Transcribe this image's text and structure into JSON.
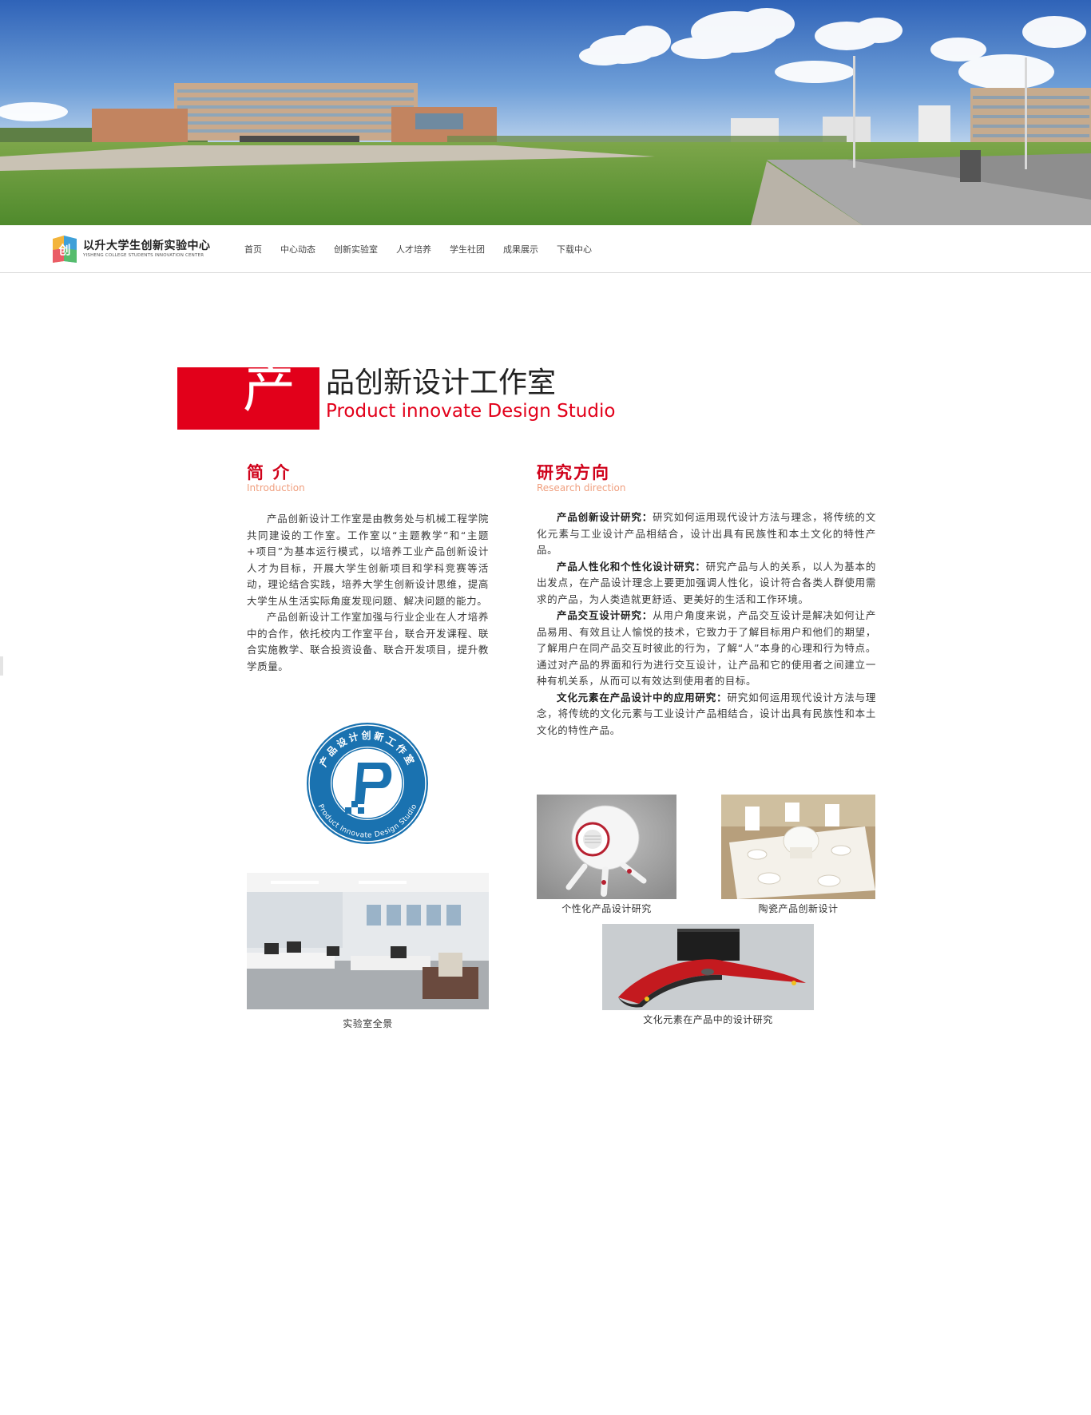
{
  "brand": {
    "name_cn": "以升大学生创新实验中心",
    "name_en": "YISHENG COLLEGE STUDENTS INNOVATION CENTER"
  },
  "nav": {
    "items": [
      "首页",
      "中心动态",
      "创新实验室",
      "人才培养",
      "学生社团",
      "成果展示",
      "下载中心"
    ]
  },
  "page_title": {
    "char": "产",
    "rest_cn": "品创新设计工作室",
    "en": "Product innovate Design Studio"
  },
  "intro": {
    "heading_cn": "简 介",
    "heading_en": "Introduction",
    "paragraphs": [
      "产品创新设计工作室是由教务处与机械工程学院共同建设的工作室。工作室以“主题教学”和“主题+项目”为基本运行模式，以培养工业产品创新设计人才为目标，开展大学生创新项目和学科竞赛等活动，理论结合实践，培养大学生创新设计思维，提高大学生从生活实际角度发现问题、解决问题的能力。",
      "产品创新设计工作室加强与行业企业在人才培养中的合作，依托校内工作室平台，联合开发课程、联合实施教学、联合投资设备、联合开发项目，提升教学质量。"
    ]
  },
  "research": {
    "heading_cn": "研究方向",
    "heading_en": "Research direction",
    "items": [
      {
        "title": "产品创新设计研究：",
        "text": "研究如何运用现代设计方法与理念，将传统的文化元素与工业设计产品相结合，设计出具有民族性和本土文化的特性产品。"
      },
      {
        "title": "产品人性化和个性化设计研究：",
        "text": "研究产品与人的关系，以人为基本的出发点，在产品设计理念上要更加强调人性化，设计符合各类人群使用需求的产品，为人类造就更舒适、更美好的生活和工作环境。"
      },
      {
        "title": "产品交互设计研究：",
        "text": "从用户角度来说，产品交互设计是解决如何让产品易用、有效且让人愉悦的技术，它致力于了解目标用户和他们的期望，了解用户在同产品交互时彼此的行为，了解“人”本身的心理和行为特点。通过对产品的界面和行为进行交互设计，让产品和它的使用者之间建立一种有机关系，从而可以有效达到使用者的目标。"
      },
      {
        "title": "文化元素在产品设计中的应用研究：",
        "text": "研究如何运用现代设计方法与理念，将传统的文化元素与工业设计产品相结合，设计出具有民族性和本土文化的特性产品。"
      }
    ]
  },
  "emblem": {
    "ring_text_cn": "产品设计创新工作室",
    "ring_text_en": "Product Innovate Design Studio"
  },
  "captions": {
    "lab": "实验室全景",
    "personal": "个性化产品设计研究",
    "ceramic": "陶瓷产品创新设计",
    "culture": "文化元素在产品中的设计研究"
  },
  "colors": {
    "accent_red": "#e2001a",
    "emblem_blue": "#1a72b0",
    "heading_red": "#d0021b",
    "heading_en": "#f0a080"
  }
}
